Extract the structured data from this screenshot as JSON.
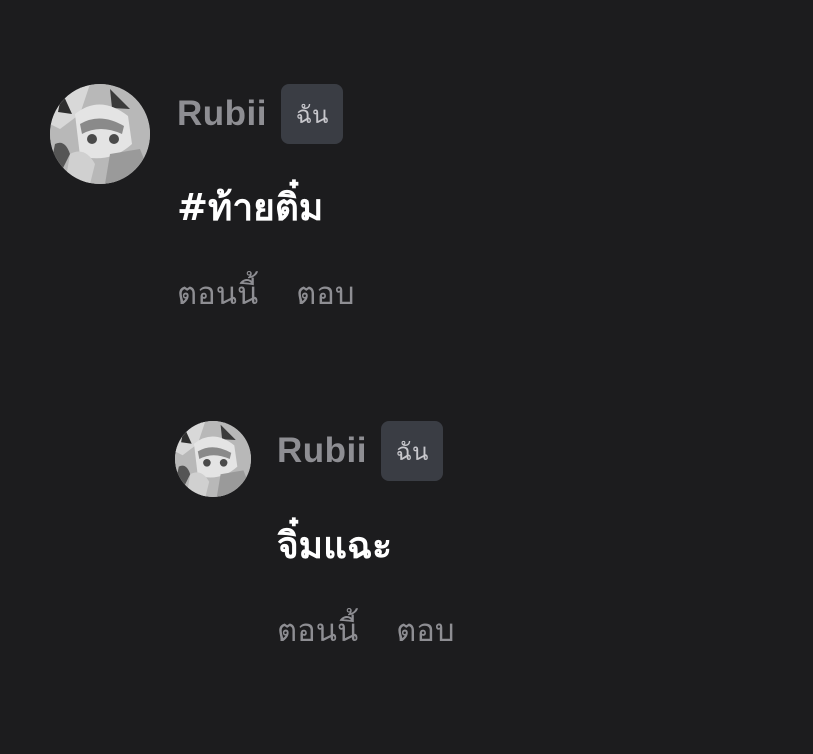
{
  "comments": [
    {
      "username": "Rubii",
      "badge": "ฉัน",
      "text": "#ท้ายติ๋ม",
      "time": "ตอนนี้",
      "reply_label": "ตอบ"
    }
  ],
  "replies": [
    {
      "username": "Rubii",
      "badge": "ฉัน",
      "text": "จิ๋มแฉะ",
      "time": "ตอนนี้",
      "reply_label": "ตอบ"
    }
  ],
  "icons": {
    "avatar": "user-avatar-anime-grayscale"
  },
  "colors": {
    "background": "#1c1c1e",
    "username": "#8e8e93",
    "badge_bg": "#3a3d44",
    "body_text": "#ffffff",
    "meta_text": "#8e8e93"
  }
}
